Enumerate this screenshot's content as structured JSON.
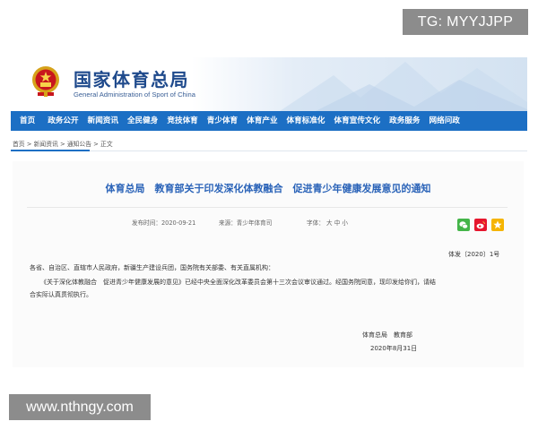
{
  "watermarks": {
    "top": "TG: MYYJJPP",
    "bottom": "www.nthngy.com"
  },
  "header": {
    "title": "国家体育总局",
    "subtitle": "General Administration of Sport of China",
    "emblem_icon": "national-emblem-icon"
  },
  "nav": {
    "items": [
      "首页",
      "政务公开",
      "新闻资讯",
      "全民健身",
      "竞技体育",
      "青少体育",
      "体育产业",
      "体育标准化",
      "体育宣传文化",
      "政务服务",
      "网络问政"
    ]
  },
  "breadcrumb": "首页 > 新闻资讯 > 通知公告 > 正文",
  "article": {
    "title": "体育总局　教育部关于印发深化体教融合　促进青少年健康发展意见的通知",
    "publish_time": "发布时间：2020-09-21",
    "source": "来源：青少年体育司",
    "font_size_label": "字体：",
    "font_size_options": "大 中 小",
    "doc_number": "体发〔2020〕1号",
    "recipients": "各省、自治区、直辖市人民政府，新疆生产建设兵团，国务院有关部委、有关直属机构：",
    "body_line1": "《关于深化体教融合　促进青少年健康发展的意见》已经中央全面深化改革委员会第十三次会议审议通过。经国务院同意，现印发给你们，请结",
    "body_line2": "合实际认真贯彻执行。",
    "signature": "体育总局　教育部",
    "date": "2020年8月31日"
  },
  "share_icons": [
    "wechat-icon",
    "weibo-icon",
    "qzone-icon"
  ],
  "colors": {
    "nav_bg": "#1c6fc4",
    "title_blue": "#2a63b8",
    "brand_blue": "#1f4a8c",
    "wechat": "#44b549",
    "weibo": "#e6162d",
    "qzone": "#f5b400"
  }
}
